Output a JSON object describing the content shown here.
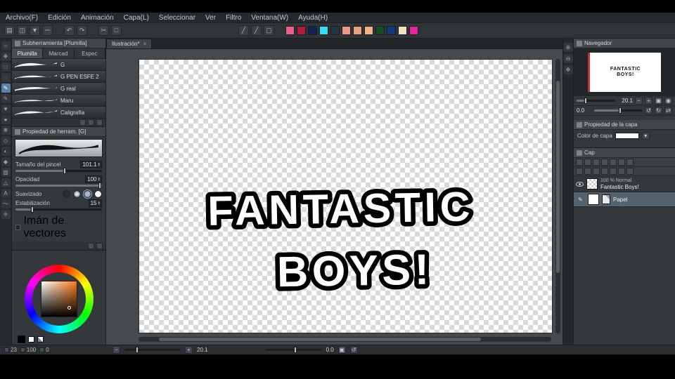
{
  "menu": {
    "items": [
      "Archivo(F)",
      "Edición",
      "Animación",
      "Capa(L)",
      "Seleccionar",
      "Ver",
      "Filtro",
      "Ventana(W)",
      "Ayuda(H)"
    ]
  },
  "toolbar": {
    "swatches": [
      "#e8638c",
      "#b01c3a",
      "#16224e",
      "#35dff0",
      "#273441",
      "#e89a8a",
      "#e8a07a",
      "#f0b088",
      "#174a22",
      "#123a78",
      "#efe0bd",
      "#e6259a"
    ]
  },
  "subtool": {
    "title": "Subherramienta [Plumilla]",
    "tabs": [
      "Plumilla",
      "Marcad",
      "Espec"
    ],
    "brushes": [
      "G",
      "G PEN ESFE 2",
      "G real",
      "Maru",
      "Caligrafía"
    ]
  },
  "toolprop": {
    "title": "Propiedad de herram. [G]",
    "size_label": "Tamaño del pincel",
    "size_value": "101.1",
    "opacity_label": "Opacidad",
    "opacity_value": "100",
    "smooth_label": "Suavizado",
    "stab_label": "Estabilización",
    "stab_value": "15",
    "vector_label": "Imán de vectores"
  },
  "colorbar": {
    "v1": "23",
    "v2": "100",
    "v3": "0"
  },
  "canvas": {
    "tab": "Ilustración*",
    "close": "×",
    "line1": "FANTASTIC",
    "line2": "BOYS!"
  },
  "status": {
    "zoom": "20.1",
    "rotation": "0.0"
  },
  "navigator": {
    "title": "Navegador",
    "zoom": "20.1",
    "rotation": "0.0",
    "thumb_line1": "FANTASTIC",
    "thumb_line2": "BOYS!",
    "btn_zoom_out": "−",
    "btn_zoom_in": "+",
    "btn_fit": "▣",
    "btn_full": "◉",
    "btn_rot_ccw": "↺",
    "btn_rot_cw": "↻",
    "btn_flip": "⇄"
  },
  "layerprop": {
    "title": "Propiedad de la capa",
    "color_label": "Color de capa"
  },
  "layers": {
    "title": "Cap",
    "row1_info": "100 % Normal",
    "row1_name": "Fantastic Boys!",
    "row2_name": "Papel"
  }
}
